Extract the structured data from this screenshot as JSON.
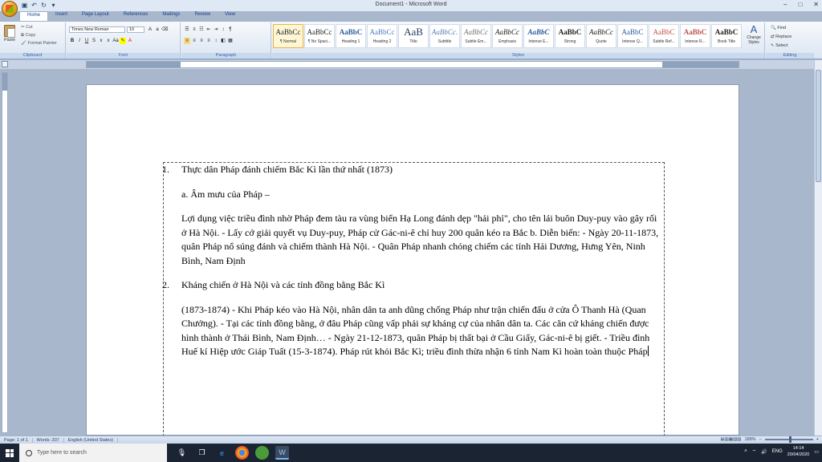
{
  "window": {
    "title": "Document1 - Microsoft Word",
    "controls": [
      "–",
      "□",
      "✕"
    ]
  },
  "tabs": [
    "Home",
    "Insert",
    "Page Layout",
    "References",
    "Mailings",
    "Review",
    "View"
  ],
  "ribbon": {
    "clipboard": {
      "paste": "Paste",
      "cut": "Cut",
      "copy": "Copy",
      "format_painter": "Format Painter",
      "label": "Clipboard"
    },
    "font": {
      "name": "Times New Roman",
      "size": "10",
      "label": "Font"
    },
    "paragraph": {
      "label": "Paragraph"
    },
    "styles": {
      "label": "Styles",
      "items": [
        {
          "sample": "AaBbCc",
          "name": "¶ Normal",
          "selected": true
        },
        {
          "sample": "AaBbCc",
          "name": "¶ No Spaci..."
        },
        {
          "sample": "AaBbC",
          "name": "Heading 1"
        },
        {
          "sample": "AaBbCc",
          "name": "Heading 2"
        },
        {
          "sample": "AaB",
          "name": "Title"
        },
        {
          "sample": "AaBbCc.",
          "name": "Subtitle"
        },
        {
          "sample": "AaBbCc",
          "name": "Subtle Em..."
        },
        {
          "sample": "AaBbCc",
          "name": "Emphasis"
        },
        {
          "sample": "AaBbC",
          "name": "Intense E..."
        },
        {
          "sample": "AaBbC",
          "name": "Strong"
        },
        {
          "sample": "AaBbCc",
          "name": "Quote"
        },
        {
          "sample": "AaBbC",
          "name": "Intense Q..."
        },
        {
          "sample": "AaBbC",
          "name": "Subtle Ref..."
        },
        {
          "sample": "AaBbC",
          "name": "Intense R..."
        },
        {
          "sample": "AaBbC",
          "name": "Book Title"
        }
      ],
      "change_styles": "Change Styles"
    },
    "editing": {
      "find": "Find",
      "replace": "Replace",
      "select": "Select",
      "label": "Editing"
    }
  },
  "document": {
    "item1_num": "1.",
    "item1_title": "Thực dân Pháp đánh chiếm Bắc Kì lần thứ nhất (1873)",
    "item1_sub": "a. Âm mưu của Pháp –",
    "item1_body": "Lợi dụng việc triều đình nhờ Pháp đem tàu ra vùng biển Hạ Long đánh dẹp \"hải phỉ\", cho tên lái buôn Duy-puy vào gây rối ở Hà Nội. - Lấy cớ giải quyết vụ Duy-puy, Pháp cử Gác-ni-ê chỉ huy 200 quân kéo ra Bắc b. Diễn biến: - Ngày 20-11-1873, quân Pháp nổ súng đánh và chiếm thành Hà Nội. - Quân Pháp nhanh chóng chiếm các tỉnh Hải Dương, Hưng Yên, Ninh Bình, Nam Định",
    "item2_num": "2.",
    "item2_title": "Kháng chiến ở Hà Nội và các tỉnh đồng bằng Bắc Kì",
    "item2_body": "(1873-1874) - Khi Pháp kéo vào Hà Nội, nhân dân ta anh dũng chống Pháp như trận chiến đấu ở cửa Ô Thanh Hà (Quan Chưởng). - Tại các tỉnh đồng bằng, ở đâu Pháp cũng vấp phải sự kháng cự của nhân dân ta. Các căn cứ kháng chiến được hình thành ở Thái Bình, Nam Định… - Ngày 21-12-1873, quân Pháp bị thất bại ở Cầu Giấy, Gác-ni-ê bị giết. - Triều đình Huế kí Hiệp ước Giáp Tuất (15-3-1874). Pháp rút khỏi Bắc Kì; triều đình thừa nhận 6 tỉnh Nam Kì hoàn toàn thuộc Pháp"
  },
  "status": {
    "page": "Page: 1 of 1",
    "words": "Words: 207",
    "language": "English (United States)",
    "zoom": "188%"
  },
  "taskbar": {
    "search_placeholder": "Type here to search",
    "language": "ENG",
    "time": "14:14",
    "date": "20/04/2020"
  }
}
